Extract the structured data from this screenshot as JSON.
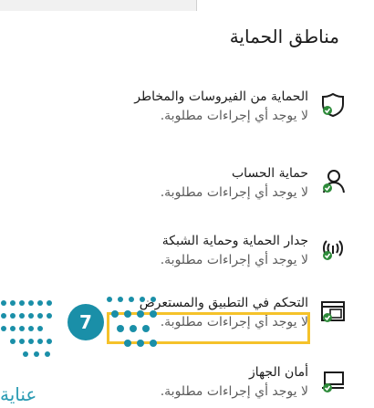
{
  "header": {
    "title": "مناطق الحماية"
  },
  "items": [
    {
      "title": "الحماية من الفيروسات والمخاطر",
      "status": "لا يوجد أي إجراءات مطلوبة.",
      "icon": "virus-shield-icon"
    },
    {
      "title": "حماية الحساب",
      "status": "لا يوجد أي إجراءات مطلوبة.",
      "icon": "account-protection-icon"
    },
    {
      "title": "جدار الحماية وحماية الشبكة",
      "status": "لا يوجد أي إجراءات مطلوبة.",
      "icon": "firewall-network-icon"
    },
    {
      "title": "التحكم في التطبيق والمستعرض",
      "status": "لا يوجد أي إجراءات مطلوبة.",
      "icon": "app-browser-control-icon"
    },
    {
      "title": "أمان الجهاز",
      "status": "لا يوجد أي إجراءات مطلوبة.",
      "icon": "device-security-icon"
    }
  ],
  "annotation": {
    "step_number": "7",
    "accent": "#1a8fa8",
    "highlight_color": "#f5c22a"
  },
  "footer_fragment": "عناية"
}
